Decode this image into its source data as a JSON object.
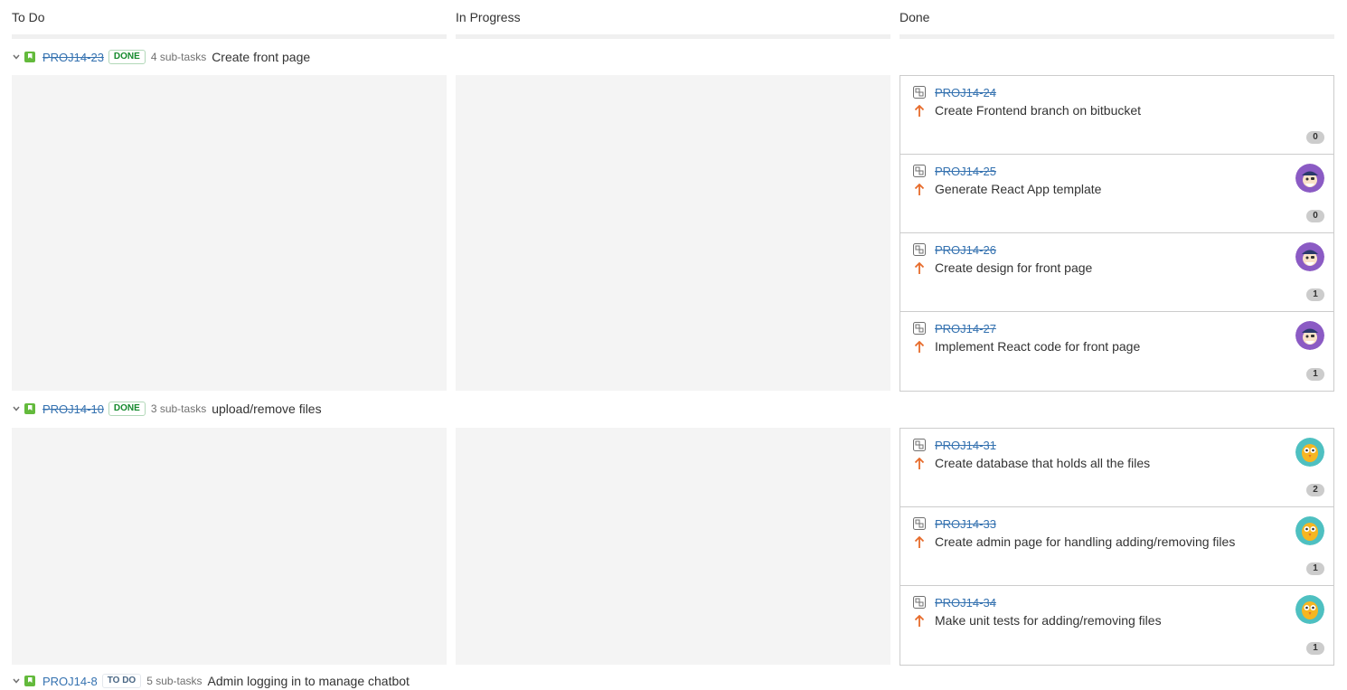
{
  "columns": [
    {
      "label": "To Do"
    },
    {
      "label": "In Progress"
    },
    {
      "label": "Done"
    }
  ],
  "swimlanes": [
    {
      "key": "PROJ14-23",
      "status": "DONE",
      "subtasks": "4 sub-tasks",
      "title": "Create front page",
      "cards": [
        {
          "key": "PROJ14-24",
          "summary": "Create Frontend branch on bitbucket",
          "badge": "0",
          "avatar": "none"
        },
        {
          "key": "PROJ14-25",
          "summary": "Generate React App template",
          "badge": "0",
          "avatar": "pirate"
        },
        {
          "key": "PROJ14-26",
          "summary": "Create design for front page",
          "badge": "1",
          "avatar": "pirate"
        },
        {
          "key": "PROJ14-27",
          "summary": "Implement React code for front page",
          "badge": "1",
          "avatar": "pirate"
        }
      ]
    },
    {
      "key": "PROJ14-10",
      "status": "DONE",
      "subtasks": "3 sub-tasks",
      "title": "upload/remove files",
      "cards": [
        {
          "key": "PROJ14-31",
          "summary": "Create database that holds all the files",
          "badge": "2",
          "avatar": "owl"
        },
        {
          "key": "PROJ14-33",
          "summary": "Create admin page for handling adding/removing files",
          "badge": "1",
          "avatar": "owl"
        },
        {
          "key": "PROJ14-34",
          "summary": "Make unit tests for adding/removing files",
          "badge": "1",
          "avatar": "owl"
        }
      ]
    },
    {
      "key": "PROJ14-8",
      "status": "TO DO",
      "subtasks": "5 sub-tasks",
      "title": "Admin logging in to manage chatbot",
      "cards": []
    }
  ],
  "icons": {
    "chevron": "chevron-down-icon",
    "story": "story-icon",
    "subtask": "subtask-icon",
    "priority": "priority-high-arrow-icon"
  },
  "colors": {
    "link": "#3572b0",
    "done_lozenge": "#14892c",
    "story_green": "#63ba3c",
    "priority_orange": "#e76b2b",
    "empty_column": "#f4f4f4",
    "avatar_purple": "#8b5bc4",
    "avatar_teal": "#4ec0c1"
  }
}
